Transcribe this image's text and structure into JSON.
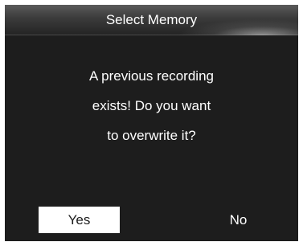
{
  "dialog": {
    "title": "Select Memory",
    "message_lines": [
      "A previous recording",
      "exists! Do you want",
      "to overwrite it?"
    ]
  },
  "buttons": {
    "yes_label": "Yes",
    "no_label": "No",
    "selected": "Yes"
  },
  "colors": {
    "background": "#1d1d1d",
    "text": "#ffffff",
    "selected_button_bg": "#ffffff",
    "selected_button_text": "#1d1d1d"
  }
}
